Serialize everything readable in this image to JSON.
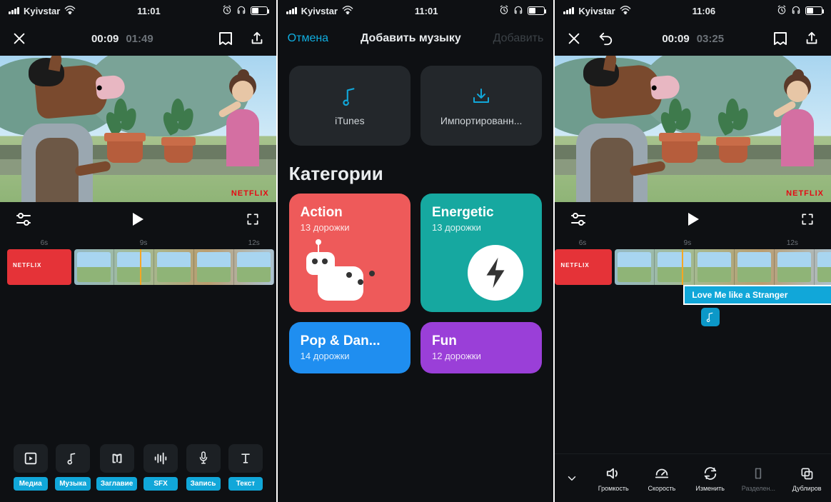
{
  "s1": {
    "status": {
      "carrier": "Kyivstar",
      "time": "11:01"
    },
    "timebar": {
      "pos": "00:09",
      "dur": "01:49"
    },
    "preview": {
      "watermark": "NETFLIX"
    },
    "ruler": {
      "a": "6s",
      "b": "9s",
      "c": "12s"
    },
    "tools": [
      {
        "name": "media",
        "label": "Медиа"
      },
      {
        "name": "music",
        "label": "Музыка"
      },
      {
        "name": "title",
        "label": "Заглавие"
      },
      {
        "name": "sfx",
        "label": "SFX"
      },
      {
        "name": "record",
        "label": "Запись"
      },
      {
        "name": "text",
        "label": "Текст"
      }
    ]
  },
  "s2": {
    "status": {
      "carrier": "Kyivstar",
      "time": "11:01"
    },
    "nav": {
      "cancel": "Отмена",
      "title": "Добавить музыку",
      "add": "Добавить"
    },
    "sources": {
      "itunes": "iTunes",
      "import": "Импортированн..."
    },
    "cats_header": "Категории",
    "cats": [
      {
        "name": "Action",
        "tracks": "13 дорожки"
      },
      {
        "name": "Energetic",
        "tracks": "13 дорожки"
      },
      {
        "name": "Pop & Dan...",
        "tracks": "14 дорожки"
      },
      {
        "name": "Fun",
        "tracks": "12 дорожки"
      }
    ]
  },
  "s3": {
    "status": {
      "carrier": "Kyivstar",
      "time": "11:06"
    },
    "timebar": {
      "pos": "00:09",
      "dur": "03:25"
    },
    "preview": {
      "watermark": "NETFLIX"
    },
    "ruler": {
      "a": "6s",
      "b": "9s",
      "c": "12s"
    },
    "audio_clip": "Love Me like a Stranger",
    "tools": [
      {
        "name": "volume",
        "label": "Громкость",
        "active": true
      },
      {
        "name": "speed",
        "label": "Скорость",
        "active": true
      },
      {
        "name": "edit",
        "label": "Изменить",
        "active": true
      },
      {
        "name": "split",
        "label": "Разделен...",
        "active": false
      },
      {
        "name": "duplicate",
        "label": "Дублиров",
        "active": true
      }
    ]
  }
}
